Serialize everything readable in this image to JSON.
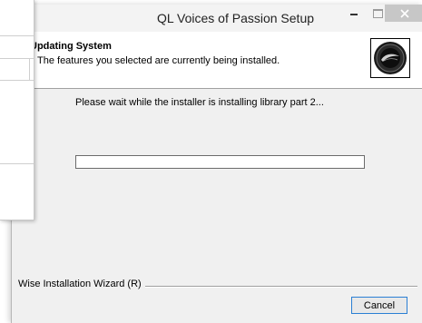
{
  "window": {
    "title": "QL Voices of Passion Setup"
  },
  "header": {
    "title": "Updating System",
    "subtitle": "The features you selected are currently being installed."
  },
  "main": {
    "status": "Please wait while the installer is installing library part 2...",
    "progress": 0
  },
  "footer": {
    "brand": "Wise Installation Wizard (R)",
    "cancel_label": "Cancel"
  },
  "icons": {
    "minimize": "minimize-icon",
    "maximize": "maximize-icon",
    "close": "close-icon",
    "logo": "product-logo-icon"
  },
  "colors": {
    "close_button": "#c7c7c7",
    "focus_border": "#2a7fd4",
    "progress_fill": "#06b025"
  }
}
